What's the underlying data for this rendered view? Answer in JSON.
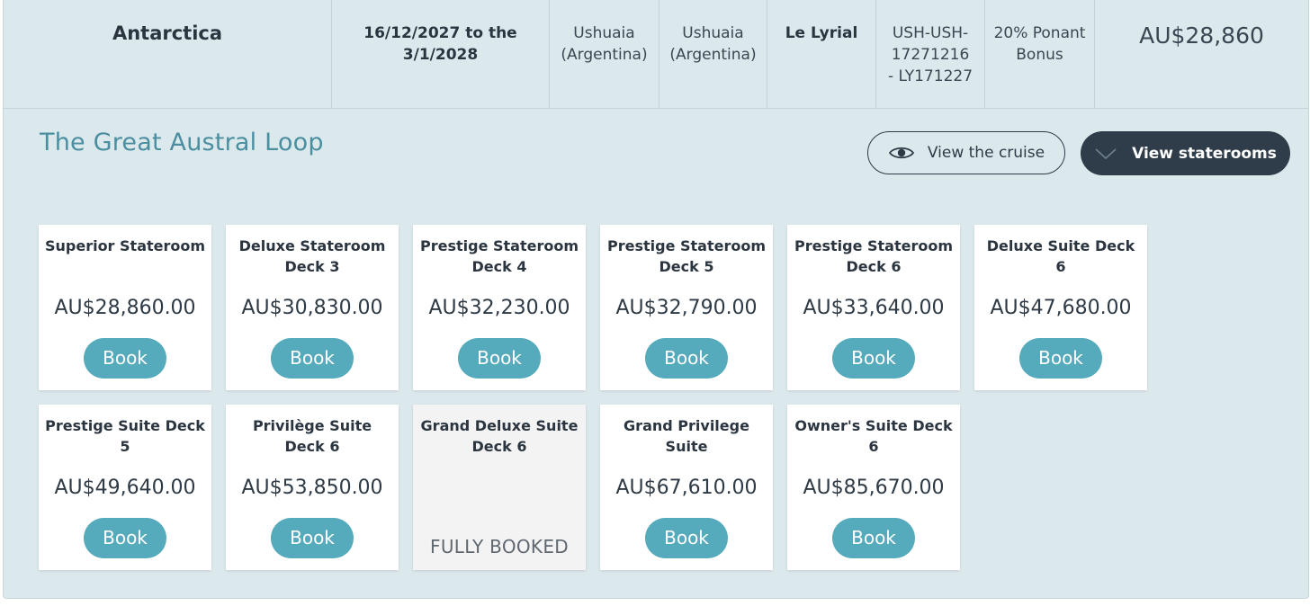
{
  "summary": {
    "destination": "Antarctica",
    "dates": "16/12/2027 to the 3/1/2028",
    "departure": "Ushuaia (Argentina)",
    "arrival": "Ushuaia (Argentina)",
    "ship": "Le Lyrial",
    "code": "USH-USH-17271216 - LY171227",
    "offer": "20% Ponant Bonus",
    "price": "AU$28,860"
  },
  "cruise": {
    "name": "The Great Austral Loop",
    "view_cruise_label": "View the cruise",
    "view_staterooms_label": "View staterooms"
  },
  "icons": {
    "view_cruise": "eye-icon",
    "view_staterooms": "chevron-down-icon"
  },
  "colors": {
    "accent": "#55aabb",
    "dark_button": "#2f3c4a",
    "panel_bg": "#dce9ec",
    "title": "#4a8ea0"
  },
  "staterooms": [
    {
      "name": "Superior Stateroom",
      "price": "AU$28,860.00",
      "action": "Book"
    },
    {
      "name": "Deluxe Stateroom Deck 3",
      "price": "AU$30,830.00",
      "action": "Book"
    },
    {
      "name": "Prestige Stateroom Deck 4",
      "price": "AU$32,230.00",
      "action": "Book"
    },
    {
      "name": "Prestige Stateroom Deck 5",
      "price": "AU$32,790.00",
      "action": "Book"
    },
    {
      "name": "Prestige Stateroom Deck 6",
      "price": "AU$33,640.00",
      "action": "Book"
    },
    {
      "name": "Deluxe Suite Deck 6",
      "price": "AU$47,680.00",
      "action": "Book"
    },
    {
      "name": "Prestige Suite Deck 5",
      "price": "AU$49,640.00",
      "action": "Book"
    },
    {
      "name": "Privilège Suite Deck 6",
      "price": "AU$53,850.00",
      "action": "Book"
    },
    {
      "name": "Grand Deluxe Suite Deck 6",
      "status": "FULLY BOOKED"
    },
    {
      "name": "Grand Privilege Suite",
      "price": "AU$67,610.00",
      "action": "Book"
    },
    {
      "name": "Owner's Suite Deck 6",
      "price": "AU$85,670.00",
      "action": "Book"
    }
  ]
}
